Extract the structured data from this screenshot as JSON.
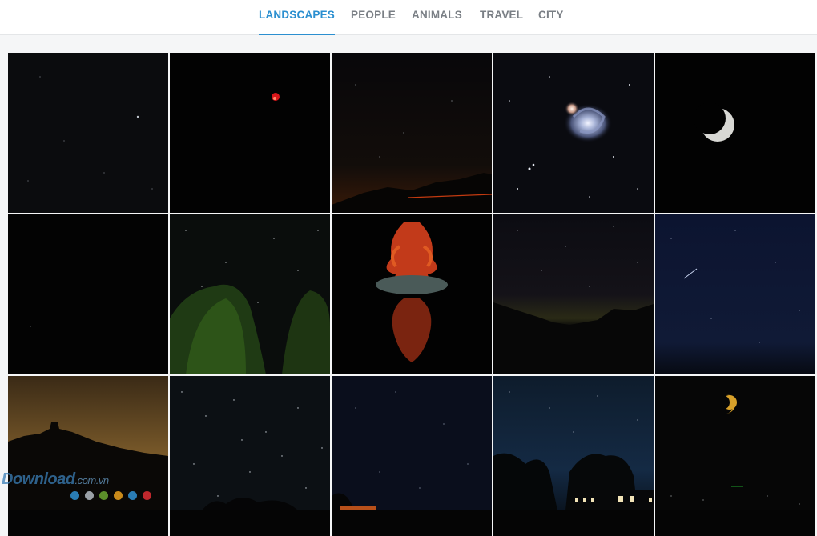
{
  "nav": {
    "tabs": [
      {
        "label": "LANDSCAPES",
        "active": true
      },
      {
        "label": "PEOPLE",
        "active": false
      },
      {
        "label": "ANIMALS",
        "active": false
      },
      {
        "label": "TRAVEL",
        "active": false
      },
      {
        "label": "CITY",
        "active": false
      }
    ],
    "accent_color": "#2b8fd0"
  },
  "gallery": {
    "photos": [
      {
        "subject": "starry-sky"
      },
      {
        "subject": "red-sky-lantern"
      },
      {
        "subject": "stars-over-mountains-orange-glow"
      },
      {
        "subject": "spiral-galaxy"
      },
      {
        "subject": "crescent-moon"
      },
      {
        "subject": "dark-night-sky"
      },
      {
        "subject": "trees-under-stars"
      },
      {
        "subject": "red-tree-on-island-reflection"
      },
      {
        "subject": "milky-way-over-mountain-lake"
      },
      {
        "subject": "shooting-star-blue-sky"
      },
      {
        "subject": "hill-silhouette-orange-sky"
      },
      {
        "subject": "dense-star-field"
      },
      {
        "subject": "milky-way-dark-blue"
      },
      {
        "subject": "trees-and-house-under-stars"
      },
      {
        "subject": "orange-half-moon"
      }
    ]
  },
  "watermark": {
    "brand": "Download",
    "domain": ".com.vn"
  },
  "watermark_dot_colors": [
    "#2a7db5",
    "#9aa0a6",
    "#5c8f2a",
    "#c98a1a",
    "#2a7db5",
    "#c0282d"
  ]
}
